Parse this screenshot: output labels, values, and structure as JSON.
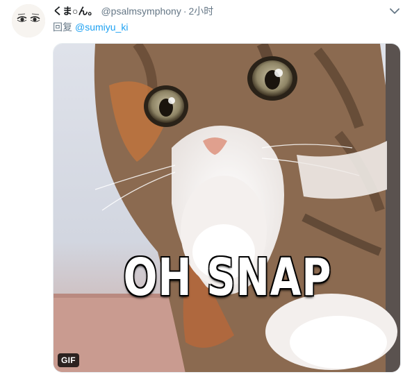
{
  "tweet": {
    "display_name": "くま○ん。",
    "handle": "@psalmsymphony",
    "separator": "·",
    "time": "2小时",
    "reply_prefix": "回复",
    "reply_mention": "@sumiyu_ki"
  },
  "media": {
    "caption": "OH SNAP",
    "badge": "GIF"
  },
  "icons": {
    "caret": "chevron-down-icon",
    "avatar": "avatar-face"
  },
  "colors": {
    "link": "#1da1f2",
    "secondary_text": "#657786",
    "primary_text": "#14171a"
  }
}
